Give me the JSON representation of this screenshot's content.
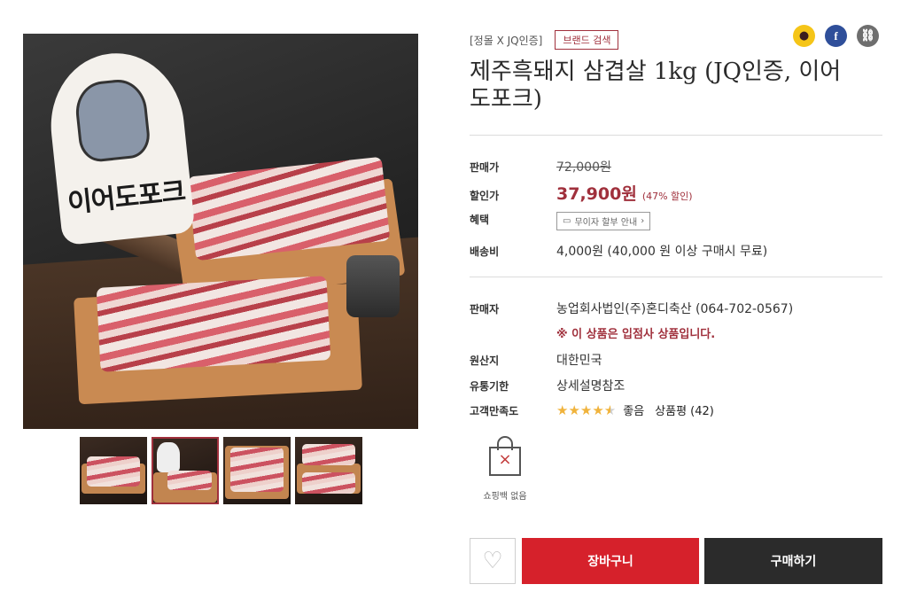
{
  "brand": {
    "name": "[정몰 X JQ인증]",
    "search_label": "브랜드 검색"
  },
  "share_icons": [
    "kakao-icon",
    "facebook-icon",
    "link-icon"
  ],
  "product": {
    "title": "제주흑돼지 삼겹살 1kg (JQ인증, 이어도포크)",
    "logo_text": "이어도포크"
  },
  "price": {
    "sale_price_label": "판매가",
    "original": "72,000원",
    "discount_label": "할인가",
    "discounted": "37,900원",
    "discount_rate": "(47% 할인)"
  },
  "benefit": {
    "label": "혜택",
    "button": "무이자 할부 안내"
  },
  "shipping": {
    "label": "배송비",
    "value": "4,000원 (40,000 원 이상 구매시 무료)"
  },
  "seller": {
    "label": "판매자",
    "value": "농업회사법인(주)혼디축산  (064-702-0567)",
    "notice": "※ 이 상품은 입점사 상품입니다."
  },
  "origin": {
    "label": "원산지",
    "value": "대한민국"
  },
  "expiry": {
    "label": "유통기한",
    "value": "상세설명참조"
  },
  "satisfaction": {
    "label": "고객만족도",
    "rating": 4.5,
    "max": 5,
    "word": "좋음",
    "review_text": "상품평 (42)"
  },
  "shopping_bag": {
    "label": "쇼핑백 없음"
  },
  "actions": {
    "cart": "장바구니",
    "buy": "구매하기"
  },
  "thumbnails": {
    "count": 4,
    "active_index": 1
  },
  "colors": {
    "accent": "#a0303c",
    "cart": "#d6212b",
    "buy": "#2b2b2b",
    "star": "#f0b33c"
  }
}
